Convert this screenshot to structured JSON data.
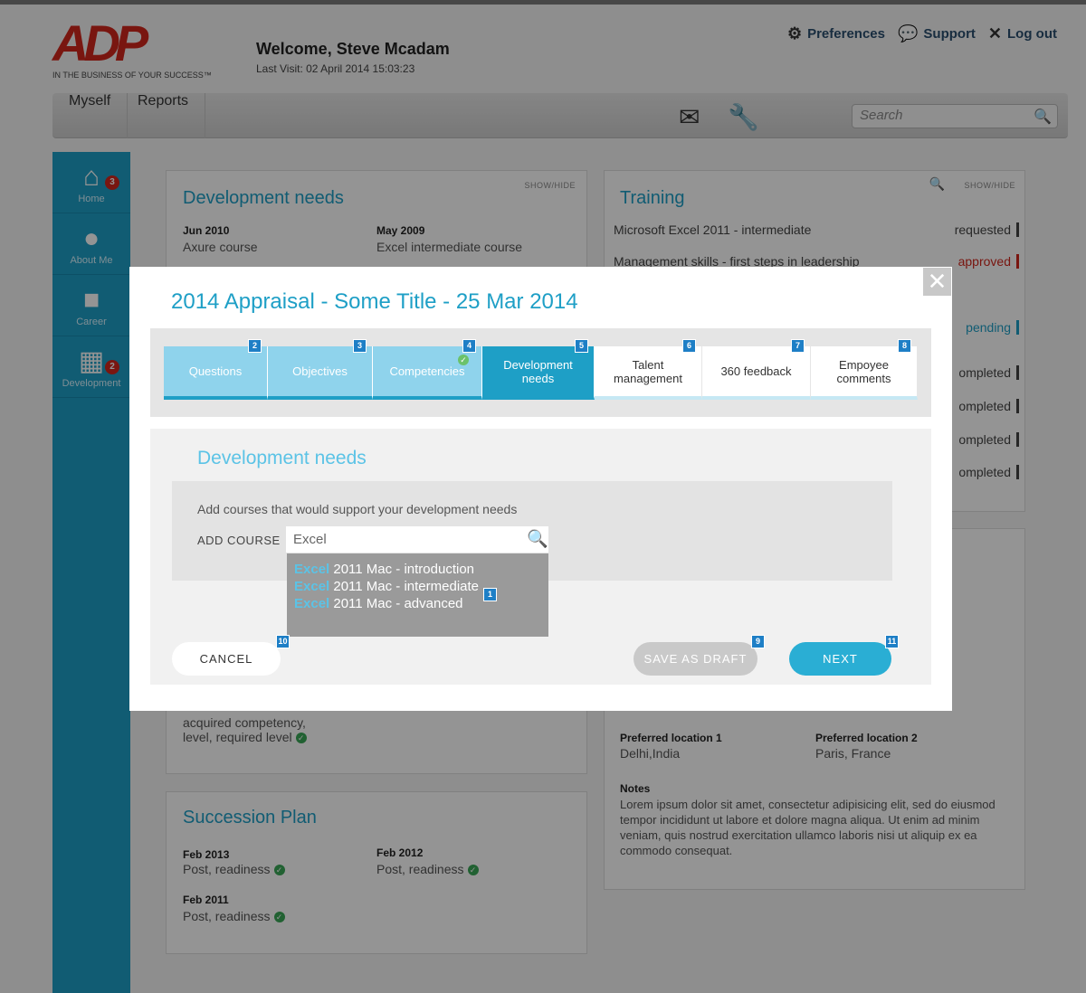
{
  "header": {
    "logo_text": "ADP",
    "logo_tagline": "IN THE BUSINESS OF YOUR SUCCESS™",
    "welcome": "Welcome, Steve Mcadam",
    "last_visit": "Last Visit: 02 April 2014 15:03:23",
    "links": {
      "preferences": "Preferences",
      "support": "Support",
      "logout": "Log out"
    }
  },
  "nav": {
    "myself": "Myself",
    "reports": "Reports",
    "search_placeholder": "Search"
  },
  "sidebar": {
    "items": [
      {
        "label": "Home",
        "badge": "3",
        "icon": "home-icon"
      },
      {
        "label": "About Me",
        "badge": "",
        "icon": "person-icon"
      },
      {
        "label": "Career",
        "badge": "",
        "icon": "briefcase-icon"
      },
      {
        "label": "Development",
        "badge": "2",
        "icon": "bricks-icon"
      }
    ]
  },
  "background": {
    "dev_needs": {
      "title": "Development needs",
      "showhide": "SHOW/HIDE",
      "entries": [
        {
          "date": "Jun 2010",
          "value": "Axure course"
        },
        {
          "date": "May 2009",
          "value": "Excel intermediate course"
        }
      ],
      "footer_line1": "acquired competency,",
      "footer_line2": "level, required level"
    },
    "training": {
      "title": "Training",
      "showhide": "SHOW/HIDE",
      "rows": [
        {
          "name": "Microsoft Excel 2011 - intermediate",
          "status": "requested"
        },
        {
          "name": "Management skills - first steps in leadership",
          "status": "approved"
        },
        {
          "name": "",
          "status": "pending"
        },
        {
          "name": "",
          "status": "ompleted"
        },
        {
          "name": "",
          "status": "ompleted"
        },
        {
          "name": "",
          "status": "ompleted"
        },
        {
          "name": "",
          "status": "ompleted"
        }
      ]
    },
    "preferences": {
      "loc1_label": "Preferred location 1",
      "loc1_value": "Delhi,India",
      "loc2_label": "Preferred location 2",
      "loc2_value": "Paris, France",
      "notes_label": "Notes",
      "notes_text": "Lorem ipsum dolor sit amet, consectetur adipisicing elit, sed do eiusmod tempor incididunt ut labore et dolore magna aliqua. Ut enim ad minim veniam, quis nostrud exercitation ullamco laboris nisi ut aliquip ex ea commodo consequat."
    },
    "succession": {
      "title": "Succession Plan",
      "entries": [
        {
          "date": "Feb 2013",
          "value": "Post, readiness"
        },
        {
          "date": "Feb 2012",
          "value": "Post, readiness"
        },
        {
          "date": "Feb 2011",
          "value": "Post, readiness"
        }
      ]
    }
  },
  "modal": {
    "title": "2014 Appraisal - Some Title - 25 Mar 2014",
    "close": "✕",
    "steps": [
      {
        "num": "2",
        "label": "Questions",
        "state": "done"
      },
      {
        "num": "3",
        "label": "Objectives",
        "state": "done"
      },
      {
        "num": "4",
        "label": "Competencies",
        "state": "done"
      },
      {
        "num": "5",
        "label": "Development needs",
        "state": "active"
      },
      {
        "num": "6",
        "label": "Talent management",
        "state": "todo"
      },
      {
        "num": "7",
        "label": "360 feedback",
        "state": "todo"
      },
      {
        "num": "8",
        "label": "Empoyee comments",
        "state": "todo"
      }
    ],
    "section_title": "Development needs",
    "description": "Add courses that would support your development needs",
    "add_course_label": "ADD COURSE",
    "course_input_value": "Excel",
    "suggestions": [
      {
        "highlight": "Excel",
        "rest": " 2011 Mac - introduction"
      },
      {
        "highlight": "Excel",
        "rest": " 2011 Mac - intermediate"
      },
      {
        "highlight": "Excel",
        "rest": " 2011 Mac - advanced"
      }
    ],
    "suggestion_marker": "1",
    "buttons": {
      "cancel": "CANCEL",
      "cancel_num": "10",
      "draft": "SAVE AS DRAFT",
      "draft_num": "9",
      "next": "NEXT",
      "next_num": "11"
    }
  },
  "colors": {
    "accent": "#1e9fc6",
    "brand_red": "#d0271d",
    "approved": "#d0271d"
  }
}
